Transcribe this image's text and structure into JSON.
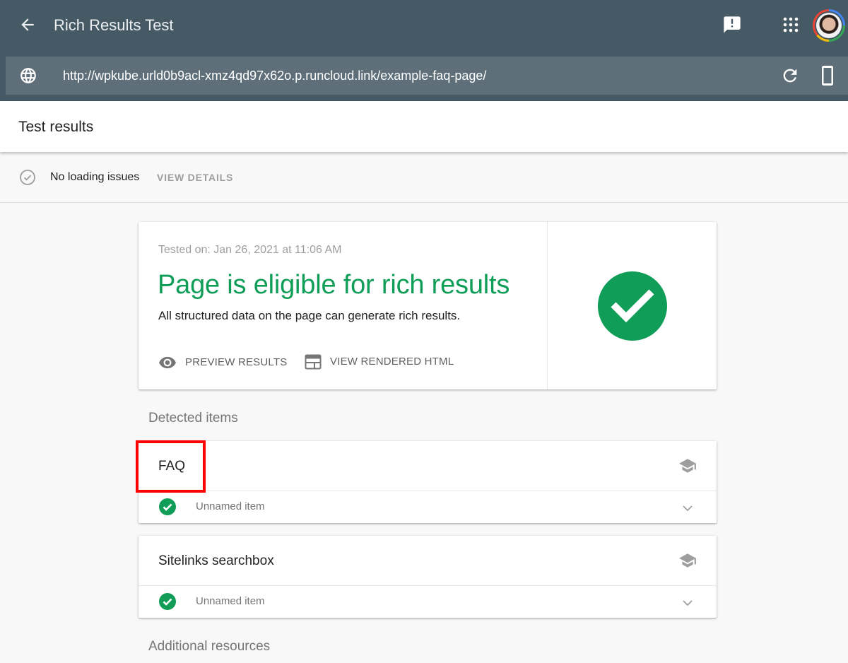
{
  "appbar": {
    "title": "Rich Results Test",
    "icons": {
      "back": "arrow-back-icon",
      "feedback": "feedback-icon",
      "apps": "apps-grid-icon",
      "avatar": "account-avatar"
    }
  },
  "urlbar": {
    "url": "http://wpkube.urld0b9acl-xmz4qd97x62o.p.runcloud.link/example-faq-page/",
    "icons": {
      "globe": "globe-icon",
      "refresh": "refresh-icon",
      "device": "smartphone-icon"
    }
  },
  "results_header": {
    "title": "Test results"
  },
  "loading": {
    "status": "No loading issues",
    "link": "VIEW DETAILS"
  },
  "summary": {
    "tested_on": "Tested on: Jan 26, 2021 at 11:06 AM",
    "headline": "Page is eligible for rich results",
    "subtext": "All structured data on the page can generate rich results.",
    "actions": [
      {
        "label": "PREVIEW RESULTS",
        "icon": "eye-icon"
      },
      {
        "label": "VIEW RENDERED HTML",
        "icon": "web-page-icon"
      }
    ],
    "status_color": "#0f9d58"
  },
  "detected": {
    "label": "Detected items",
    "items": [
      {
        "name": "FAQ",
        "entries": [
          {
            "label": "Unnamed item",
            "status": "valid"
          }
        ]
      },
      {
        "name": "Sitelinks searchbox",
        "entries": [
          {
            "label": "Unnamed item",
            "status": "valid"
          }
        ]
      }
    ]
  },
  "additional": {
    "label": "Additional resources"
  },
  "annotation": {
    "highlight_color": "#ff0000",
    "highlight_target": "FAQ"
  }
}
